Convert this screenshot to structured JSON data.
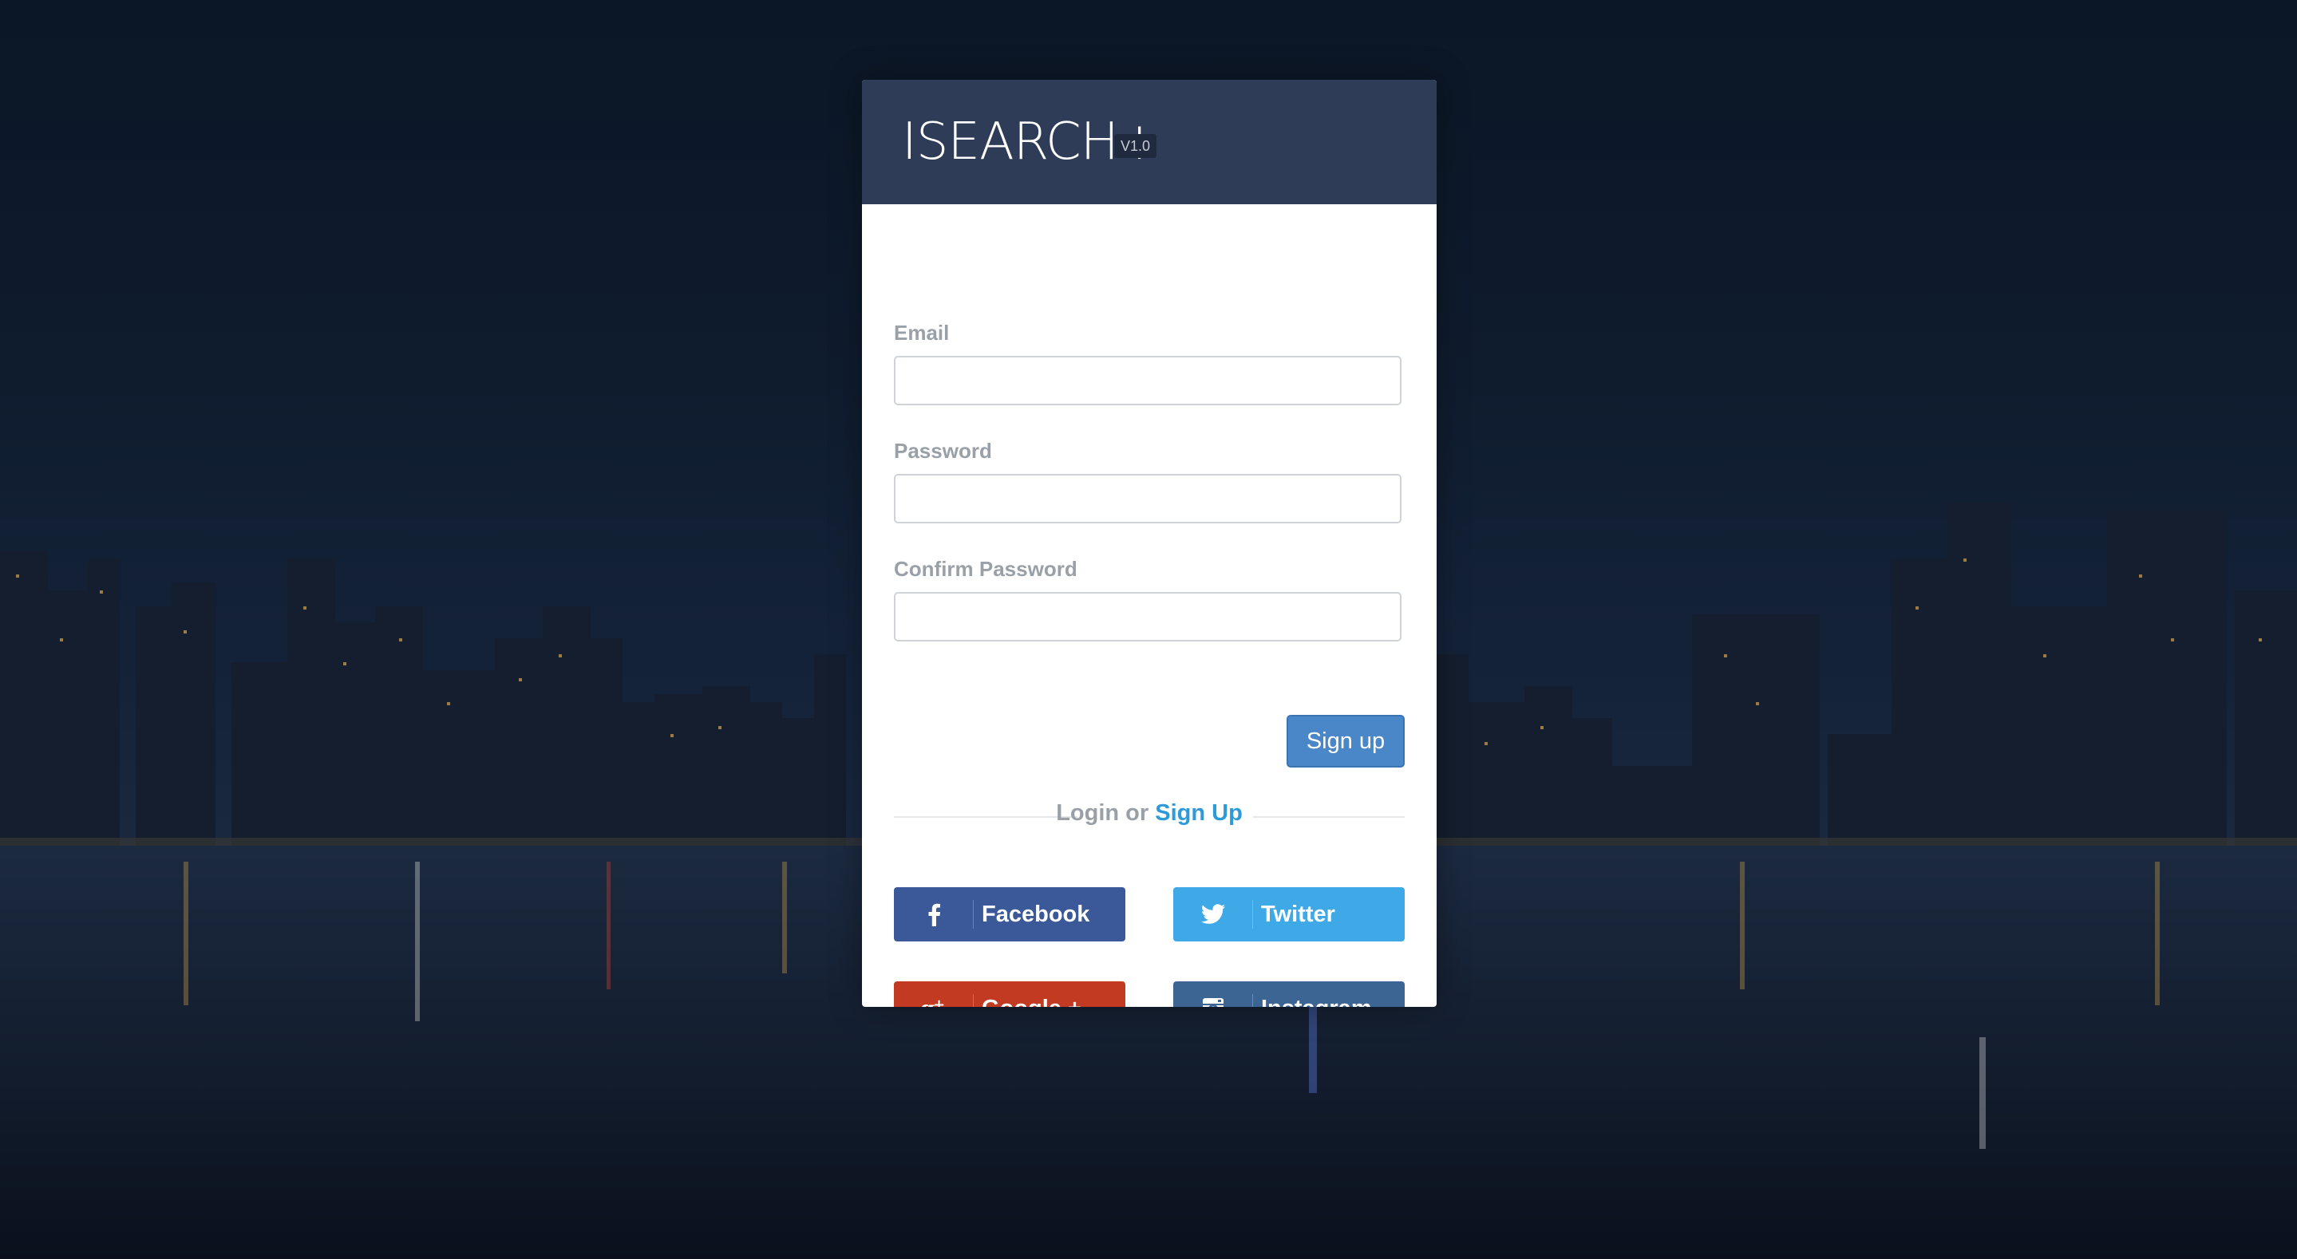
{
  "brand": {
    "title": "ISEARCH+",
    "version": "V1.0"
  },
  "form": {
    "email": {
      "label": "Email",
      "value": "",
      "placeholder": ""
    },
    "password": {
      "label": "Password",
      "value": "",
      "placeholder": ""
    },
    "confirm_password": {
      "label": "Confirm Password",
      "value": "",
      "placeholder": ""
    },
    "submit_label": "Sign up"
  },
  "divider": {
    "prefix": "Login or ",
    "link": "Sign Up"
  },
  "social": {
    "facebook": {
      "label": "Facebook",
      "icon": "facebook-icon",
      "color": "#3b5898"
    },
    "twitter": {
      "label": "Twitter",
      "icon": "twitter-icon",
      "color": "#3fa9e8"
    },
    "google": {
      "label": "Google +",
      "icon": "google-plus-icon",
      "color": "#c23a22"
    },
    "instagram": {
      "label": "Instagram",
      "icon": "instagram-icon",
      "color": "#3d6594"
    }
  },
  "colors": {
    "header": "#2e3c57",
    "primary_button": "#4a87c8",
    "link": "#2f9ad8"
  }
}
